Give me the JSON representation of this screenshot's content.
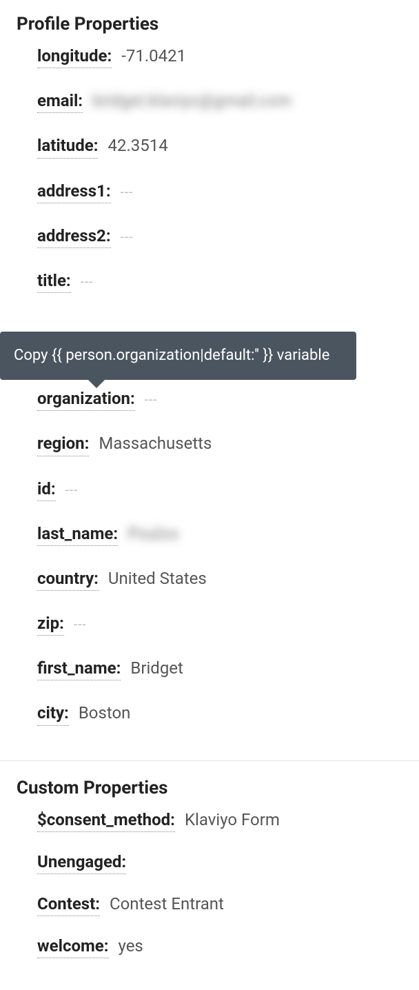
{
  "profile": {
    "title": "Profile Properties",
    "props": {
      "longitude": {
        "label": "longitude:",
        "value": "-71.0421"
      },
      "email": {
        "label": "email:",
        "value": "bridget.klaviyo@gmail.com"
      },
      "latitude": {
        "label": "latitude:",
        "value": "42.3514"
      },
      "address1": {
        "label": "address1:",
        "value": "---"
      },
      "address2": {
        "label": "address2:",
        "value": "---"
      },
      "title_field": {
        "label": "title:",
        "value": "---"
      },
      "organization": {
        "label": "organization:",
        "value": "---"
      },
      "region": {
        "label": "region:",
        "value": "Massachusetts"
      },
      "id": {
        "label": "id:",
        "value": "---"
      },
      "last_name": {
        "label": "last_name:",
        "value": "Poulos"
      },
      "country": {
        "label": "country:",
        "value": "United States"
      },
      "zip": {
        "label": "zip:",
        "value": "---"
      },
      "first_name": {
        "label": "first_name:",
        "value": "Bridget"
      },
      "city": {
        "label": "city:",
        "value": "Boston"
      }
    },
    "tooltip": "Copy {{ person.organization|default:'' }} variable"
  },
  "custom": {
    "title": "Custom Properties",
    "props": {
      "consent_method": {
        "label": "$consent_method:",
        "value": "Klaviyo Form"
      },
      "unengaged": {
        "label": "Unengaged:",
        "value": ""
      },
      "contest": {
        "label": "Contest:",
        "value": "Contest Entrant"
      },
      "welcome": {
        "label": "welcome:",
        "value": "yes"
      }
    }
  }
}
